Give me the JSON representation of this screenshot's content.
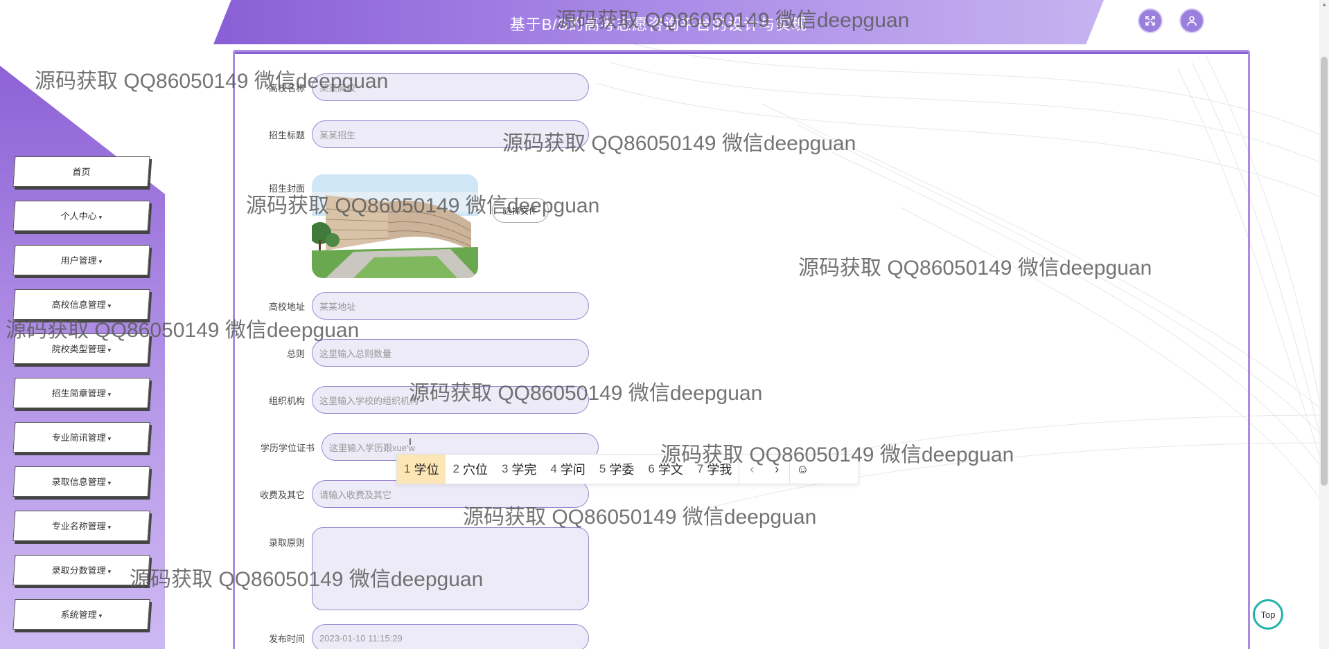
{
  "header": {
    "title": "基于B/S的高考志愿咨询平台的设计与实现",
    "fullscreen_icon": "fullscreen-icon",
    "user_icon": "user-icon"
  },
  "sidebar": {
    "items": [
      {
        "label": "首页",
        "has_caret": false
      },
      {
        "label": "个人中心",
        "has_caret": true
      },
      {
        "label": "用户管理",
        "has_caret": true
      },
      {
        "label": "高校信息管理",
        "has_caret": true
      },
      {
        "label": "院校类型管理",
        "has_caret": true
      },
      {
        "label": "招生简章管理",
        "has_caret": true
      },
      {
        "label": "专业简讯管理",
        "has_caret": true
      },
      {
        "label": "录取信息管理",
        "has_caret": true
      },
      {
        "label": "专业名称管理",
        "has_caret": true
      },
      {
        "label": "录取分数管理",
        "has_caret": true
      },
      {
        "label": "系统管理",
        "has_caret": true
      }
    ],
    "caret": "▾"
  },
  "form": {
    "school_name": {
      "label": "高校名称",
      "value": "某某高校"
    },
    "title": {
      "label": "招生标题",
      "value": "某某招生"
    },
    "cover": {
      "label": "招生封面",
      "button": "选择文件"
    },
    "address": {
      "label": "高校地址",
      "value": "某某地址"
    },
    "general": {
      "label": "总则",
      "placeholder": "这里输入总则数量"
    },
    "organization": {
      "label": "组织机构",
      "placeholder": "这里输入学校的组织机构"
    },
    "degree": {
      "label": "学历学位证书",
      "value": "这里输入学历跟xue'w"
    },
    "fees": {
      "label": "收费及其它",
      "placeholder": "请输入收费及其它"
    },
    "admission": {
      "label": "录取原则",
      "value": ""
    },
    "publish_time": {
      "label": "发布时间",
      "value": "2023-01-10 11:15:29"
    }
  },
  "ime": {
    "candidates": [
      {
        "num": "1",
        "text": "学位"
      },
      {
        "num": "2",
        "text": "穴位"
      },
      {
        "num": "3",
        "text": "学完"
      },
      {
        "num": "4",
        "text": "学问"
      },
      {
        "num": "5",
        "text": "学委"
      },
      {
        "num": "6",
        "text": "学文"
      },
      {
        "num": "7",
        "text": "学我"
      }
    ],
    "prev": "‹",
    "next": "›",
    "emoji": "☺"
  },
  "top_button": "Top",
  "watermark": "源码获取 QQ86050149 微信deepguan",
  "colors": {
    "accent": "#8a5fd6",
    "top_ring": "#20b2aa",
    "ime_active": "#fde6b5"
  }
}
